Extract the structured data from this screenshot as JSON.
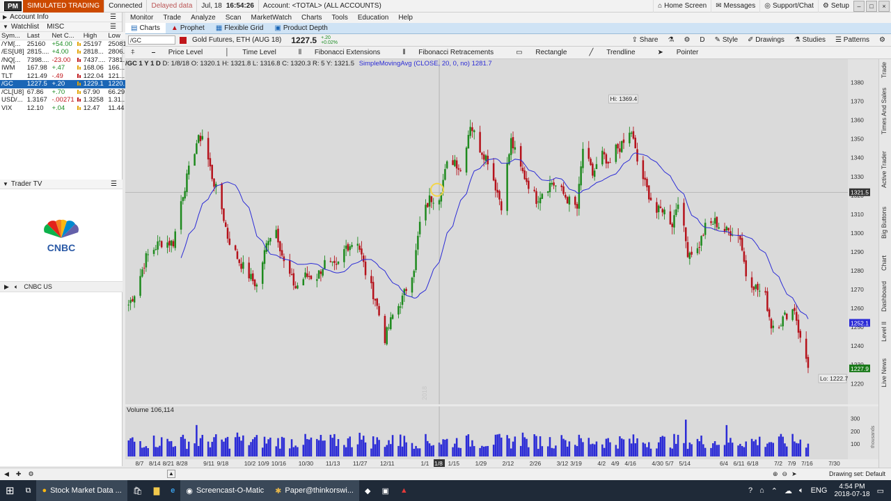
{
  "titlebar": {
    "badge": "PM",
    "mode": "SIMULATED TRADING",
    "connection": "Connected",
    "data_status": "Delayed data",
    "date": "Jul, 18",
    "time": "16:54:26",
    "account": "Account: <TOTAL> (ALL ACCOUNTS)",
    "home": "Home Screen",
    "messages": "Messages",
    "support": "Support/Chat",
    "setup": "Setup"
  },
  "left_panel": {
    "account_info": "Account Info",
    "watchlist_title": "Watchlist",
    "watchlist_name": "MISC",
    "columns": [
      "Sym...",
      "Last",
      "Net C...",
      "",
      "High",
      "Low"
    ],
    "rows": [
      {
        "sym": "/YM[...",
        "last": "25160",
        "net": "+54.00",
        "high": "25197",
        "low": "25081",
        "dir": "pos"
      },
      {
        "sym": "/ES[U8]",
        "last": "2815....",
        "net": "+4.00",
        "high": "2818...",
        "low": "2806...",
        "dir": "pos"
      },
      {
        "sym": "/NQ[...",
        "last": "7398....",
        "net": "-23.00",
        "high": "7437....",
        "low": "7381...",
        "dir": "neg"
      },
      {
        "sym": "IWM",
        "last": "167.98",
        "net": "+.47",
        "high": "168.06",
        "low": "166....",
        "dir": "pos"
      },
      {
        "sym": "TLT",
        "last": "121.49",
        "net": "-.49",
        "high": "122.04",
        "low": "121....",
        "dir": "neg"
      },
      {
        "sym": "/GC",
        "last": "1227.5",
        "net": "+.20",
        "high": "1229.1",
        "low": "1220....",
        "dir": "sel"
      },
      {
        "sym": "/CL[U8]",
        "last": "67.86",
        "net": "+.70",
        "high": "67.90",
        "low": "66.29",
        "dir": "pos"
      },
      {
        "sym": "USD/...",
        "last": "1.3167",
        "net": "-.00271",
        "high": "1.3258",
        "low": "1.31...",
        "dir": "neg"
      },
      {
        "sym": "VIX",
        "last": "12.10",
        "net": "+.04",
        "high": "12.47",
        "low": "11.44",
        "dir": "pos"
      }
    ],
    "trader_tv": "Trader TV",
    "cnbc_logo": "CNBC",
    "channel": "CNBC US"
  },
  "menu": [
    "Monitor",
    "Trade",
    "Analyze",
    "Scan",
    "MarketWatch",
    "Charts",
    "Tools",
    "Education",
    "Help"
  ],
  "tabs": [
    "Charts",
    "Prophet",
    "Flexible Grid",
    "Product Depth"
  ],
  "symbol_bar": {
    "symbol": "/GC",
    "description": "Gold Futures, ETH (AUG 18)",
    "price": "1227.5",
    "change": "+.20",
    "change_pct": "+0.02%",
    "share": "Share",
    "period": "D",
    "style": "Style",
    "drawings": "Drawings",
    "studies": "Studies",
    "patterns": "Patterns"
  },
  "drawing_tools": [
    "Price Level",
    "Time Level",
    "Fibonacci Extensions",
    "Fibonacci Retracements",
    "Rectangle",
    "Trendline",
    "Pointer"
  ],
  "study_line": {
    "label": "/GC 1 Y 1 D",
    "ohlc": "D: 1/8/18  O: 1320.1  H: 1321.8  L: 1316.8  C: 1320.3  R: 5  Y: 1321.5",
    "study": "SimpleMovingAvg (CLOSE, 20, 0, no) 1281.7"
  },
  "volume_label": "Volume 106,114",
  "chart_data": {
    "type": "candlestick",
    "symbol": "/GC",
    "ylim": [
      1215,
      1385
    ],
    "y_ticks": [
      1220,
      1230,
      1240,
      1250,
      1260,
      1270,
      1280,
      1290,
      1300,
      1310,
      1320,
      1330,
      1340,
      1350,
      1360,
      1370,
      1380
    ],
    "x_ticks": [
      "8/7",
      "8/14",
      "8/21",
      "8/28",
      "9/11",
      "9/18",
      "10/2",
      "10/9",
      "10/16",
      "10/30",
      "11/13",
      "11/27",
      "12/11",
      "1/1",
      "1/8",
      "1/15",
      "1/29",
      "2/12",
      "2/26",
      "3/12",
      "3/19",
      "4/2",
      "4/9",
      "4/16",
      "4/30",
      "5/7",
      "5/14",
      "6/4",
      "6/11",
      "6/18",
      "7/2",
      "7/9",
      "7/16",
      "7/30"
    ],
    "high_label": "Hi: 1369.4",
    "low_label": "Lo: 1222.7",
    "crosshair_price": "1321.5",
    "sma_price": "1252.1",
    "last_price": "1227.9",
    "year_marker": "2018",
    "volume_ticks": [
      "300",
      "200",
      "100"
    ],
    "volume_unit": "thousands",
    "close_path": [
      [
        "8/1",
        1262
      ],
      [
        "8/4",
        1268
      ],
      [
        "8/10",
        1287
      ],
      [
        "8/17",
        1295
      ],
      [
        "8/24",
        1295
      ],
      [
        "8/28",
        1317
      ],
      [
        "9/1",
        1333
      ],
      [
        "9/5",
        1348
      ],
      [
        "9/8",
        1352
      ],
      [
        "9/13",
        1330
      ],
      [
        "9/18",
        1313
      ],
      [
        "9/21",
        1298
      ],
      [
        "9/27",
        1285
      ],
      [
        "10/3",
        1276
      ],
      [
        "10/6",
        1272
      ],
      [
        "10/12",
        1298
      ],
      [
        "10/16",
        1302
      ],
      [
        "10/20",
        1284
      ],
      [
        "10/26",
        1271
      ],
      [
        "10/31",
        1277
      ],
      [
        "11/6",
        1277
      ],
      [
        "11/10",
        1284
      ],
      [
        "11/16",
        1281
      ],
      [
        "11/21",
        1293
      ],
      [
        "11/27",
        1296
      ],
      [
        "12/1",
        1279
      ],
      [
        "12/6",
        1265
      ],
      [
        "12/11",
        1244
      ],
      [
        "12/15",
        1256
      ],
      [
        "12/20",
        1265
      ],
      [
        "12/26",
        1282
      ],
      [
        "12/29",
        1305
      ],
      [
        "1/3",
        1318
      ],
      [
        "1/8",
        1320
      ],
      [
        "1/12",
        1336
      ],
      [
        "1/16",
        1339
      ],
      [
        "1/19",
        1333
      ],
      [
        "1/24",
        1358
      ],
      [
        "1/29",
        1345
      ],
      [
        "2/2",
        1339
      ],
      [
        "2/6",
        1325
      ],
      [
        "2/9",
        1315
      ],
      [
        "2/14",
        1349
      ],
      [
        "2/19",
        1334
      ],
      [
        "2/22",
        1328
      ],
      [
        "2/27",
        1318
      ],
      [
        "3/2",
        1322
      ],
      [
        "3/7",
        1327
      ],
      [
        "3/12",
        1322
      ],
      [
        "3/15",
        1318
      ],
      [
        "3/20",
        1313
      ],
      [
        "3/23",
        1345
      ],
      [
        "3/28",
        1331
      ],
      [
        "4/2",
        1342
      ],
      [
        "4/5",
        1334
      ],
      [
        "4/9",
        1345
      ],
      [
        "4/12",
        1346
      ],
      [
        "4/17",
        1354
      ],
      [
        "4/20",
        1338
      ],
      [
        "4/25",
        1323
      ],
      [
        "4/30",
        1311
      ],
      [
        "5/3",
        1313
      ],
      [
        "5/8",
        1305
      ],
      [
        "5/11",
        1318
      ],
      [
        "5/16",
        1290
      ],
      [
        "5/21",
        1291
      ],
      [
        "5/25",
        1303
      ],
      [
        "5/30",
        1306
      ],
      [
        "6/4",
        1301
      ],
      [
        "6/8",
        1301
      ],
      [
        "6/12",
        1298
      ],
      [
        "6/15",
        1278
      ],
      [
        "6/20",
        1271
      ],
      [
        "6/25",
        1266
      ],
      [
        "6/28",
        1251
      ],
      [
        "7/3",
        1253
      ],
      [
        "7/6",
        1257
      ],
      [
        "7/10",
        1260
      ],
      [
        "7/13",
        1243
      ],
      [
        "7/17",
        1230
      ]
    ]
  },
  "bottom": {
    "drawing_set": "Drawing set: Default"
  },
  "right_tabs": [
    "Trade",
    "Times And Sales",
    "Active Trader",
    "Big Buttons",
    "Chart",
    "Dashboard",
    "Level II",
    "Live News"
  ],
  "taskbar": {
    "items": [
      "Stock Market Data ...",
      "Screencast-O-Matic",
      "Paper@thinkorswi..."
    ],
    "lang": "ENG",
    "clock_time": "4:54 PM",
    "clock_date": "2018-07-18"
  },
  "colors": {
    "up": "#1e8a1e",
    "down": "#b5121b",
    "sma": "#2b2bd6",
    "accent": "#1b66b6",
    "sim": "#cc4a00"
  }
}
